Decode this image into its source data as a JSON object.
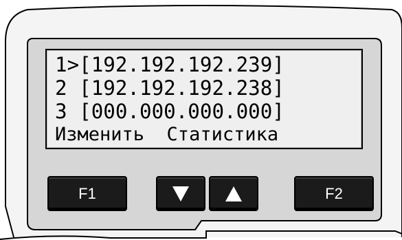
{
  "lcd": {
    "line1": "1>[192.192.192.239]",
    "line2": "2 [192.192.192.238]",
    "line3": "3 [000.000.000.000]",
    "line4": "Изменить  Статистика"
  },
  "keys": {
    "f1": "F1",
    "f2": "F2",
    "down_icon": "down-arrow-icon",
    "up_icon": "up-arrow-icon"
  },
  "colors": {
    "lcd_background": "#efefef",
    "panel": "#d6d6d6",
    "key": "#1b1b1b",
    "key_label": "#ffffff"
  }
}
